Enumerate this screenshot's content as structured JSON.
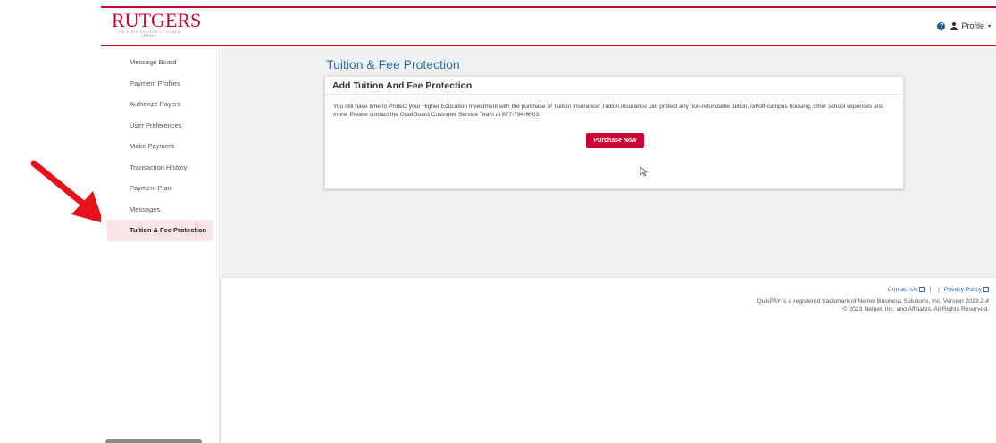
{
  "header": {
    "logo_text": "RUTGERS",
    "logo_subtitle": "THE STATE UNIVERSITY OF NEW JERSEY",
    "help_symbol": "?",
    "profile_label": "Profile",
    "caret": "▾"
  },
  "sidebar": {
    "items": [
      {
        "label": "Message Board"
      },
      {
        "label": "Payment Profiles"
      },
      {
        "label": "Authorize Payers"
      },
      {
        "label": "User Preferences"
      },
      {
        "label": "Make Payment"
      },
      {
        "label": "Transaction History"
      },
      {
        "label": "Payment Plan"
      },
      {
        "label": "Messages"
      },
      {
        "label": "Tuition & Fee Protection"
      }
    ],
    "active_index": 8
  },
  "main": {
    "page_title": "Tuition & Fee Protection",
    "card_title": "Add Tuition And Fee Protection",
    "card_text": "You still have time to Protect your Higher Education Investment with the purchase of Tuition Insurance! Tuition Insurance can protect any non-refundable tuition, on/off-campus housing, other school expenses and more. Please contact the GradGuard Customer Service Team at 877-794-6603.",
    "purchase_button": "Purchase Now"
  },
  "footer": {
    "contact_us": "Contact Us",
    "separator": "|",
    "privacy_policy": "Privacy Policy",
    "trademark": "QuikPAY is a registered trademark of Nelnet Business Solutions, Inc. Version 2023.2.4",
    "copyright": "© 2023 Nelnet, Inc. and Affiliates. All Rights Reserved."
  },
  "colors": {
    "brand_red": "#cc0033",
    "link_blue": "#2a6fa8",
    "arrow_red": "#e8101a"
  }
}
